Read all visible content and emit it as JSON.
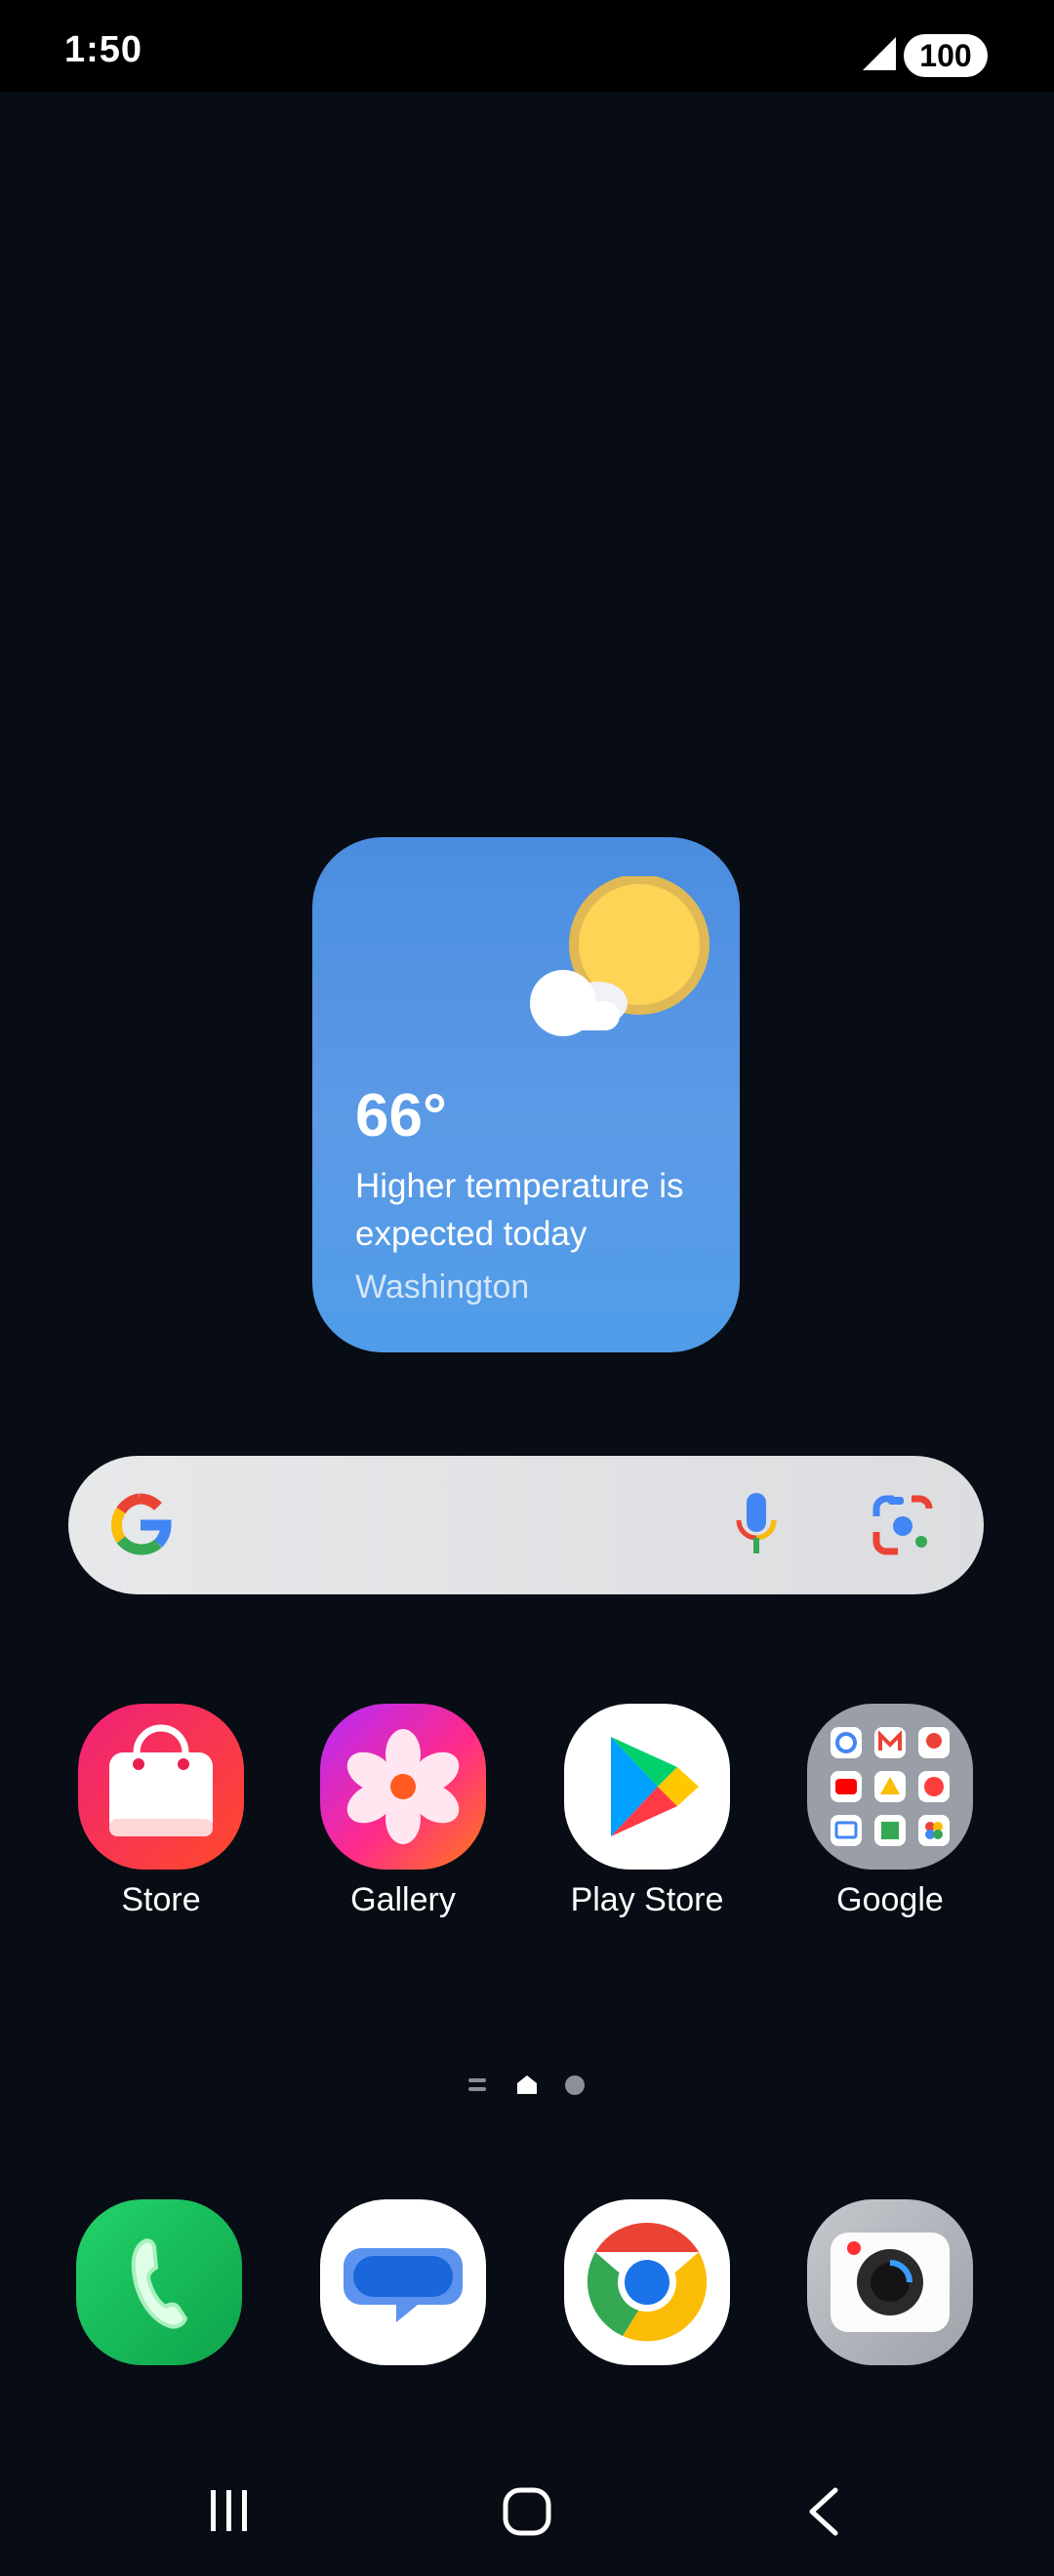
{
  "status_bar": {
    "time": "1:50",
    "battery": "100"
  },
  "weather": {
    "temperature": "66°",
    "description": "Higher temperature is expected today",
    "city": "Washington"
  },
  "search": {},
  "apps": [
    {
      "label": "Store"
    },
    {
      "label": "Gallery"
    },
    {
      "label": "Play Store"
    },
    {
      "label": "Google"
    }
  ],
  "dock": [
    {
      "icon": "phone-icon"
    },
    {
      "icon": "messages-icon"
    },
    {
      "icon": "chrome-icon"
    },
    {
      "icon": "camera-icon"
    }
  ],
  "page_indicator": {
    "pages": [
      "menu",
      "home",
      "page"
    ],
    "active": "home"
  },
  "nav_bar": [
    "recents-button",
    "home-button",
    "back-button"
  ]
}
